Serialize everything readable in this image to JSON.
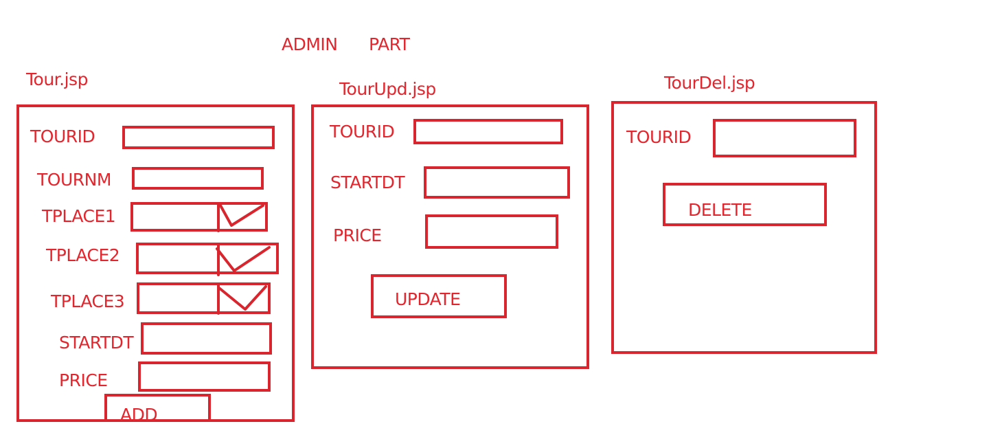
{
  "title_left": "ADMIN",
  "title_right": "PART",
  "colors": {
    "ink": "#d9262e",
    "text": "#e3262e",
    "background": "#ffffff"
  },
  "tour": {
    "page_name": "Tour.jsp",
    "fields": {
      "tourid": "TOURID",
      "tournm": "TOURNM",
      "tplace1": "TPLACE1",
      "tplace2": "TPLACE2",
      "tplace3": "TPLACE3",
      "startdt": "STARTDT",
      "price": "PRICE"
    },
    "dropdown_icon": "chevron-down-icon",
    "button_label": "ADD"
  },
  "tour_upd": {
    "page_name": "TourUpd.jsp",
    "fields": {
      "tourid": "TOURID",
      "startdt": "STARTDT",
      "price": "PRICE"
    },
    "button_label": "UPDATE"
  },
  "tour_del": {
    "page_name": "TourDel.jsp",
    "fields": {
      "tourid": "TOURID"
    },
    "button_label": "DELETE"
  }
}
